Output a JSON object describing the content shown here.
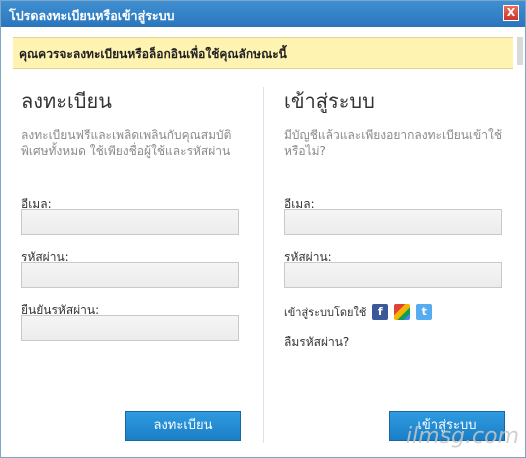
{
  "window": {
    "title": "โปรดลงทะเบียนหรือเข้าสู่ระบบ",
    "close_label": "X"
  },
  "notice": {
    "text": "คุณควรจะลงทะเบียนหรือล็อกอินเพื่อใช้คุณลักษณะนี้"
  },
  "register": {
    "heading": "ลงทะเบียน",
    "description": "ลงทะเบียนฟรีและเพลิดเพลินกับคุณสมบัติพิเศษทั้งหมด ใช้เพียงชื่อผู้ใช้และรหัสผ่าน",
    "email_label": "อีเมล:",
    "password_label": "รหัสผ่าน:",
    "confirm_label": "ยืนยันรหัสผ่าน:",
    "button": "ลงทะเบียน"
  },
  "login": {
    "heading": "เข้าสู่ระบบ",
    "description": "มีบัญชีแล้วและเพียงอยากลงทะเบียนเข้าใช้หรือไม่?",
    "email_label": "อีเมล:",
    "password_label": "รหัสผ่าน:",
    "social_label": "เข้าสู่ระบบโดยใช้",
    "forgot": "ลืมรหัสผ่าน?",
    "button": "เข้าสู่ระบบ"
  },
  "icons": [
    "facebook-icon",
    "google-plus-icon",
    "twitter-icon"
  ],
  "watermark": "ilmsg.com",
  "colors": {
    "title_bar": "#2a76bd",
    "button": "#1a7fc6",
    "notice_bg": "#fff3b2"
  }
}
